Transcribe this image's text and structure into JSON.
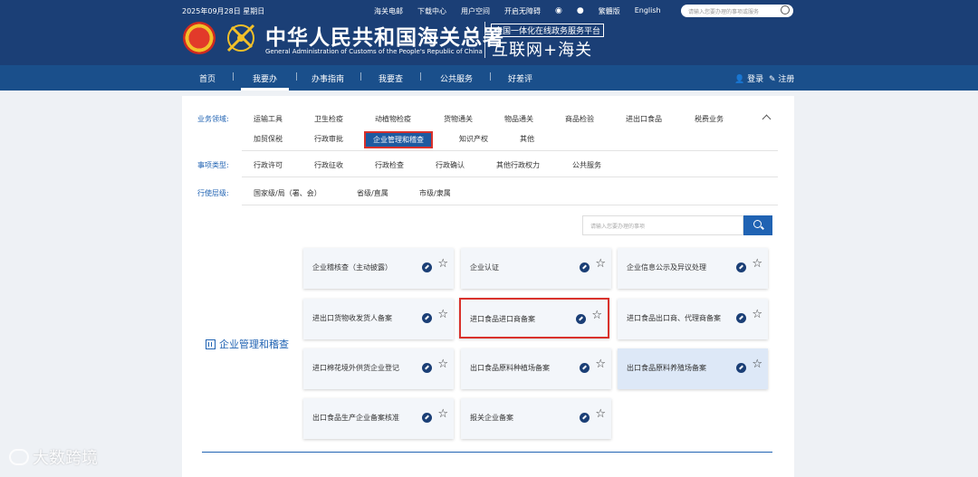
{
  "header": {
    "date": "2025年09月28日 星期日",
    "top_links": [
      "海关电邮",
      "下载中心",
      "用户空间",
      "开启无障碍"
    ],
    "lang_trad": "繁體版",
    "lang_en": "English",
    "search_placeholder": "请输入您要办理的事项或服务",
    "title_cn": "中华人民共和国海关总署",
    "title_en": "General Administration of Customs of the People's Republic of China",
    "platform": "全国一体化在线政务服务平台",
    "internet_label": "互联网+海关"
  },
  "nav": {
    "items": [
      "首页",
      "我要办",
      "办事指南",
      "我要查",
      "公共服务",
      "好差评"
    ],
    "login": "登录",
    "register": "注册"
  },
  "filters": {
    "business_label": "业务领域:",
    "business_row1": [
      "运输工具",
      "卫生检疫",
      "动植物检疫",
      "货物通关",
      "物品通关",
      "商品检验",
      "进出口食品",
      "税费业务"
    ],
    "business_row2": [
      "加贸保税",
      "行政审批",
      "企业管理和稽查",
      "知识产权",
      "其他"
    ],
    "type_label": "事项类型:",
    "types": [
      "行政许可",
      "行政征收",
      "行政检查",
      "行政确认",
      "其他行政权力",
      "公共服务"
    ],
    "level_label": "行使层级:",
    "levels": [
      "国家级/局（署、会）",
      "省级/直属",
      "市级/隶属"
    ]
  },
  "search": {
    "placeholder": "请输入您要办理的事项"
  },
  "category": {
    "title": "企业管理和稽查",
    "cards": [
      "企业稽核查（主动披露）",
      "企业认证",
      "企业信息公示及异议处理",
      "进出口货物收发货人备案",
      "进口食品进口商备案",
      "进口食品出口商、代理商备案",
      "进口棉花境外供货企业登记",
      "出口食品原料种植场备案",
      "出口食品原料养殖场备案",
      "出口食品生产企业备案核准",
      "报关企业备案"
    ]
  },
  "watermark": "大数跨境",
  "colors": {
    "header_bg": "#1b3f76",
    "nav_bg": "#1a4f8b",
    "accent": "#2063b3",
    "highlight_border": "#d9312b"
  }
}
